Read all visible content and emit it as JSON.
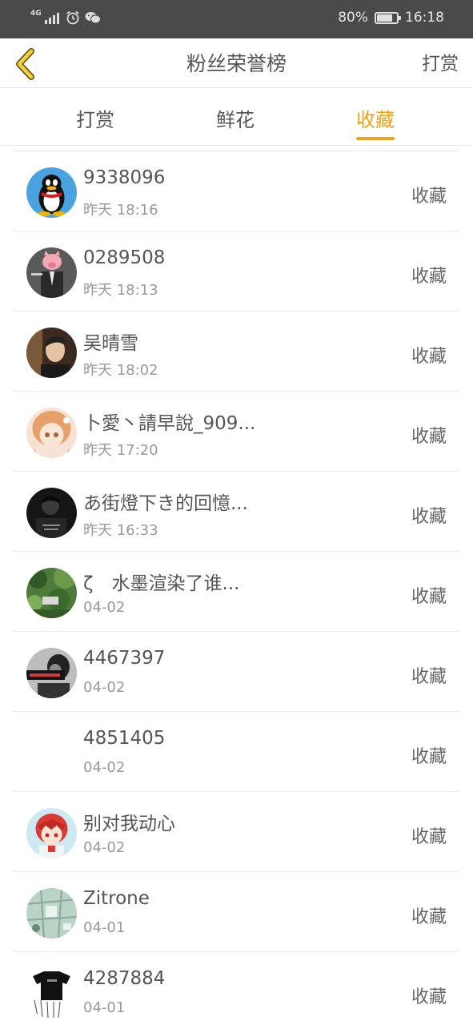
{
  "status_bar": {
    "network": "4G",
    "battery": "80%",
    "time": "16:18"
  },
  "header": {
    "title": "粉丝荣誉榜",
    "action": "打赏"
  },
  "tabs": [
    {
      "label": "打赏"
    },
    {
      "label": "鲜花"
    },
    {
      "label": "收藏"
    }
  ],
  "active_tab": "收藏",
  "items": [
    {
      "name": "9338096",
      "time": "昨天 18:16",
      "action": "收藏"
    },
    {
      "name": "0289508",
      "time": "昨天 18:13",
      "action": "收藏"
    },
    {
      "name": "吴晴雪",
      "time": "昨天 18:02",
      "action": "收藏"
    },
    {
      "name": "卜愛丶請早說_909...",
      "time": "昨天 17:20",
      "action": "收藏"
    },
    {
      "name": "あ街燈下き的回憶...",
      "time": "昨天 16:33",
      "action": "收藏"
    },
    {
      "name": "ζ　水墨渲染了谁...",
      "time": "04-02",
      "action": "收藏"
    },
    {
      "name": "4467397",
      "time": "04-02",
      "action": "收藏"
    },
    {
      "name": "4851405",
      "time": "04-02",
      "action": "收藏"
    },
    {
      "name": "别对我动心",
      "time": "04-02",
      "action": "收藏"
    },
    {
      "name": "Zitrone",
      "time": "04-01",
      "action": "收藏"
    },
    {
      "name": "4287884",
      "time": "04-01",
      "action": "收藏"
    }
  ],
  "colors": {
    "accent": "#f1a31b",
    "status_bar": "#4a4a4a",
    "text": "#555555",
    "subtext": "#999999"
  }
}
